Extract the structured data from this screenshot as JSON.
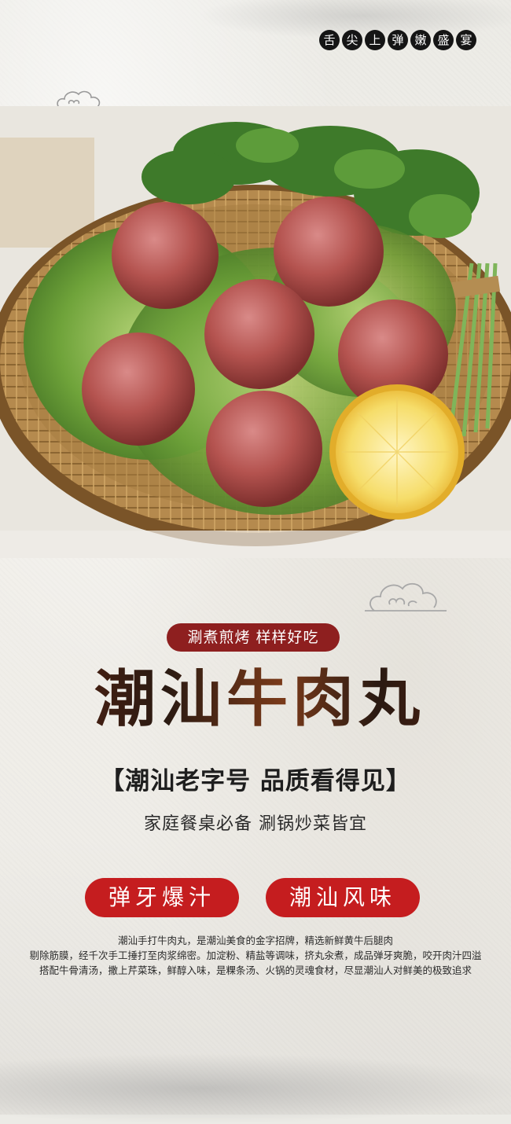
{
  "header": {
    "seal_chars": [
      "舌",
      "尖",
      "上",
      "弹",
      "嫩",
      "盛",
      "宴"
    ]
  },
  "photo": {
    "subject": "beef meatballs on lettuce in a woven bamboo tray with cilantro and lemon slice"
  },
  "tag": {
    "label": "涮煮煎烤 样样好吃"
  },
  "title": "潮汕牛肉丸",
  "subtitle": "【潮汕老字号 品质看得见】",
  "tagline": "家庭餐桌必备 涮锅炒菜皆宜",
  "features": [
    "弹牙爆汁",
    "潮汕风味"
  ],
  "description": [
    "潮汕手打牛肉丸，是潮汕美食的金字招牌，精选新鲜黄牛后腿肉",
    "剔除筋膜，经千次手工捶打至肉浆绵密。加淀粉、精盐等调味，挤丸汆煮，成品弹牙爽脆，咬开肉汁四溢",
    "搭配牛骨清汤，撒上芹菜珠，鲜醇入味，是粿条汤、火锅的灵魂食材，尽显潮汕人对鲜美的极致追求"
  ],
  "colors": {
    "tag_bg": "#8e1f1f",
    "feature_bg": "#c51d1f",
    "seal_bg": "#151515",
    "background": "#efede8"
  }
}
